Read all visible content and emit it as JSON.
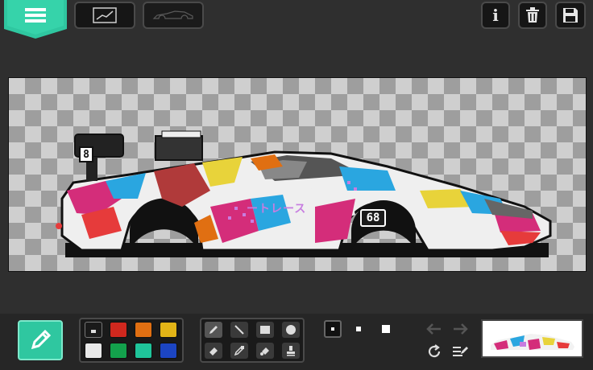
{
  "toolbar": {
    "menu_icon": "hamburger-menu-icon",
    "sketch_icon": "sketch-line-icon",
    "car_icon": "car-outline-icon",
    "info_label": "i",
    "trash_icon": "trash-icon",
    "save_icon": "floppy-disk-icon"
  },
  "canvas": {
    "car_number_left": "8",
    "car_number_door": "68",
    "livery_text": "ートレース"
  },
  "palette": {
    "colors": [
      "#1a1a1a",
      "#d0281e",
      "#e06f12",
      "#e2b417",
      "#e8e8e8",
      "#13a14c",
      "#1fc49a",
      "#1c45c2"
    ]
  },
  "tools": {
    "items": [
      "pencil-icon",
      "line-icon",
      "rectangle-icon",
      "circle-icon",
      "eraser-icon",
      "eyedropper-icon",
      "fill-bucket-icon",
      "stamp-icon"
    ]
  },
  "accent": "#2fc7a0"
}
